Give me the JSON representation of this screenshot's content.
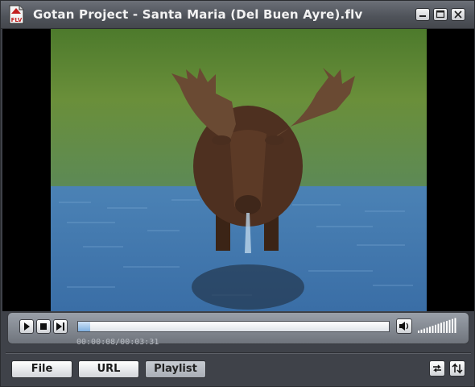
{
  "window": {
    "title": "Gotan Project - Santa Maria (Del Buen Ayre).flv",
    "app_icon": "flv-file-icon",
    "app_icon_text": "FLV",
    "controls": [
      "minimize-icon",
      "maximize-icon",
      "close-icon"
    ]
  },
  "video": {
    "content": "moose-standing-in-water"
  },
  "playback": {
    "buttons": [
      "play-icon",
      "stop-icon",
      "next-track-icon"
    ],
    "progress": 0.04,
    "time_display": "00:00:08/00:03:31",
    "volume_icon": "speaker-icon",
    "volume_level": 1.0
  },
  "bottom_bar": {
    "file_label": "File",
    "url_label": "URL",
    "playlist_label": "Playlist",
    "right_icons": [
      "repeat-icon",
      "shuffle-icon"
    ]
  },
  "colors": {
    "titlebar": "#50545b",
    "panel": "#6f747c",
    "progress_fill": "#7fb0e0"
  }
}
